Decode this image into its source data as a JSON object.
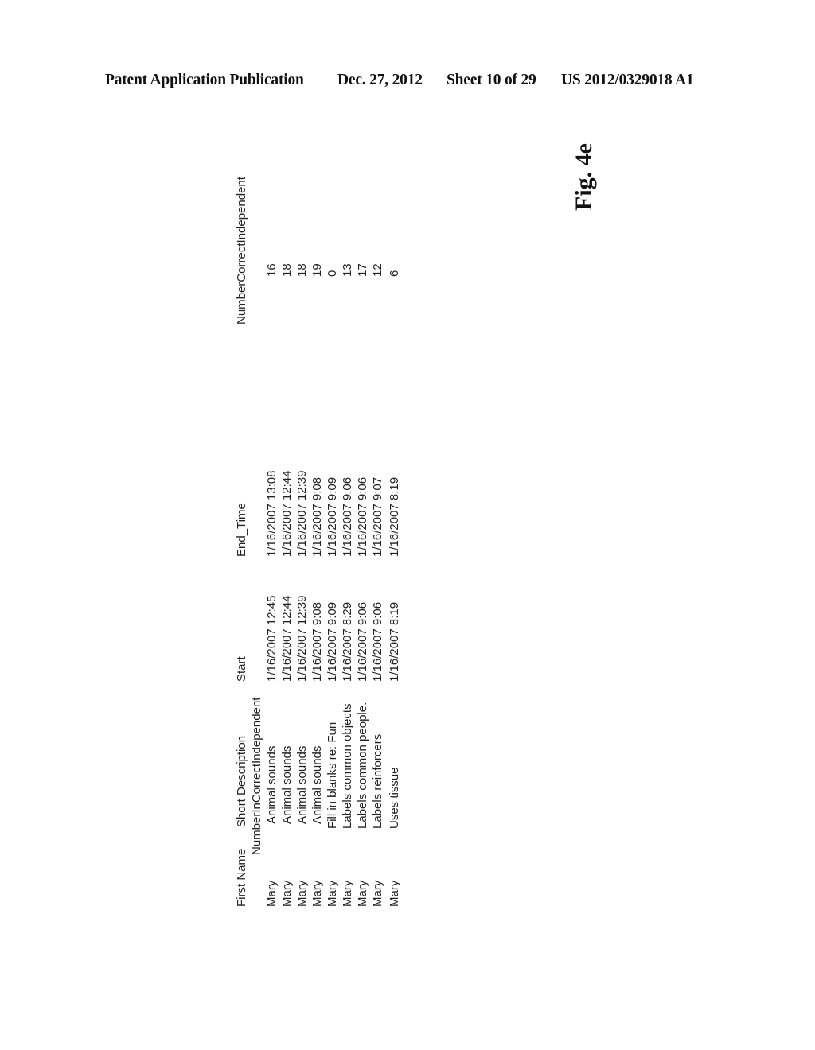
{
  "header": {
    "publication": "Patent Application Publication",
    "date": "Dec. 27, 2012",
    "sheet": "Sheet 10 of 29",
    "number": "US 2012/0329018 A1"
  },
  "figure_label": "Fig. 4e",
  "table": {
    "columns": {
      "first_name": "First Name",
      "short_description": "Short Description",
      "number_incorrect_independent": "NumberInCorrectIndependent",
      "start": "Start",
      "end_time": "End_Time",
      "number_correct_independent": "NumberCorrectIndependent"
    },
    "rows": [
      {
        "first_name": "Mary",
        "short_description": "Animal sounds",
        "start": "1/16/2007 12:45",
        "end_time": "1/16/2007 13:08",
        "number_correct_independent": "16"
      },
      {
        "first_name": "Mary",
        "short_description": "Animal sounds",
        "start": "1/16/2007 12:44",
        "end_time": "1/16/2007 12:44",
        "number_correct_independent": "18"
      },
      {
        "first_name": "Mary",
        "short_description": "Animal sounds",
        "start": "1/16/2007 12:39",
        "end_time": "1/16/2007 12:39",
        "number_correct_independent": "18"
      },
      {
        "first_name": "Mary",
        "short_description": "Animal sounds",
        "start": "1/16/2007 9:08",
        "end_time": "1/16/2007 9:08",
        "number_correct_independent": "19"
      },
      {
        "first_name": "Mary",
        "short_description": "Fill in  blanks re: Fun",
        "start": "1/16/2007 9:09",
        "end_time": "1/16/2007 9:09",
        "number_correct_independent": "0"
      },
      {
        "first_name": "Mary",
        "short_description": "Labels common objects",
        "start": "1/16/2007 8:29",
        "end_time": "1/16/2007 9:06",
        "number_correct_independent": "13"
      },
      {
        "first_name": "Mary",
        "short_description": "Labels common people.",
        "start": "1/16/2007 9:06",
        "end_time": "1/16/2007 9:06",
        "number_correct_independent": "17"
      },
      {
        "first_name": "Mary",
        "short_description": "Labels reinforcers",
        "start": "1/16/2007 9:06",
        "end_time": "1/16/2007 9:07",
        "number_correct_independent": "12"
      },
      {
        "first_name": "Mary",
        "short_description": "Uses tissue",
        "start": "1/16/2007 8:19",
        "end_time": "1/16/2007 8:19",
        "number_correct_independent": "6"
      }
    ]
  }
}
